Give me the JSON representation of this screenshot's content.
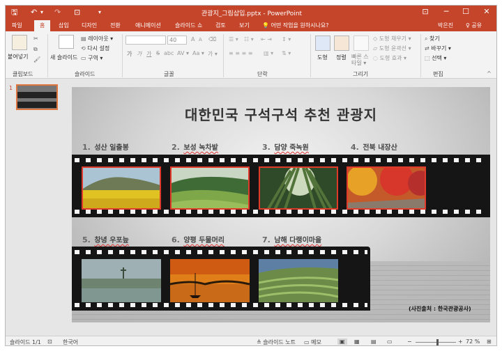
{
  "titlebar": {
    "title": "관광지_그림삽입.pptx - PowerPoint",
    "qa": {
      "save": "🖫",
      "undo": "↶",
      "undo_drop": "▾",
      "redo": "↷",
      "present": "⊡",
      "more": "▾"
    },
    "win": {
      "ribbon_opts": "⊡",
      "minimize": "─",
      "maximize": "☐",
      "close": "✕"
    }
  },
  "tabs": {
    "items": [
      "파일",
      "홈",
      "삽입",
      "디자인",
      "전환",
      "애니메이션",
      "슬라이드 쇼",
      "검토",
      "보기"
    ],
    "search": "💡 어떤 작업을 원하시나요?",
    "user": "박은진",
    "share": "♀ 공유"
  },
  "ribbon": {
    "clipboard": {
      "paste": "붙여넣기",
      "label": "클립보드"
    },
    "slides": {
      "new_slide": "새 슬라이드",
      "layout": "레이아웃 ▾",
      "reset": "다시 설정",
      "section": "구역 ▾",
      "label": "슬라이드"
    },
    "font": {
      "font_name": "",
      "font_size": "40",
      "grow": "A",
      "shrink": "A",
      "clear": "⌫",
      "bold": "가",
      "italic": "가",
      "underline": "가",
      "strike": "S",
      "shadow": "abc",
      "spacing": "AV ▾",
      "case": "Aa ▾",
      "color": "가 ▾",
      "label": "글꼴"
    },
    "paragraph": {
      "label": "단락"
    },
    "drawing": {
      "shapes": "도형",
      "arrange": "정렬",
      "quick_styles": "빠른 스타일 ▾",
      "fill": "도형 채우기 ▾",
      "outline": "도형 윤곽선 ▾",
      "effects": "도형 효과 ▾",
      "label": "그리기"
    },
    "editing": {
      "find": "찾기",
      "replace": "바꾸기 ▾",
      "select": "선택 ▾",
      "label": "편집"
    }
  },
  "thumbs": [
    {
      "num": "1"
    }
  ],
  "slide": {
    "title": "대한민국 구석구석 추천 관광지",
    "row1": [
      {
        "num": "1.",
        "name": "성산 일출봉"
      },
      {
        "num": "2.",
        "name": "보성 녹차밭"
      },
      {
        "num": "3.",
        "name": "담양 죽녹원"
      },
      {
        "num": "4.",
        "name": "전북 내장산"
      }
    ],
    "row2": [
      {
        "num": "5.",
        "name": "창녕 우포늪"
      },
      {
        "num": "6.",
        "name": "양평 두물머리"
      },
      {
        "num": "7.",
        "name": "남해 다랭이마을"
      }
    ],
    "credit": "(사진출처 : 한국관광공사)"
  },
  "status": {
    "slide_info": "슬라이드 1/1",
    "language": "한국어",
    "notes": "≙ 슬라이드 노트",
    "comments": "▭ 메모",
    "zoom": "72 %"
  }
}
